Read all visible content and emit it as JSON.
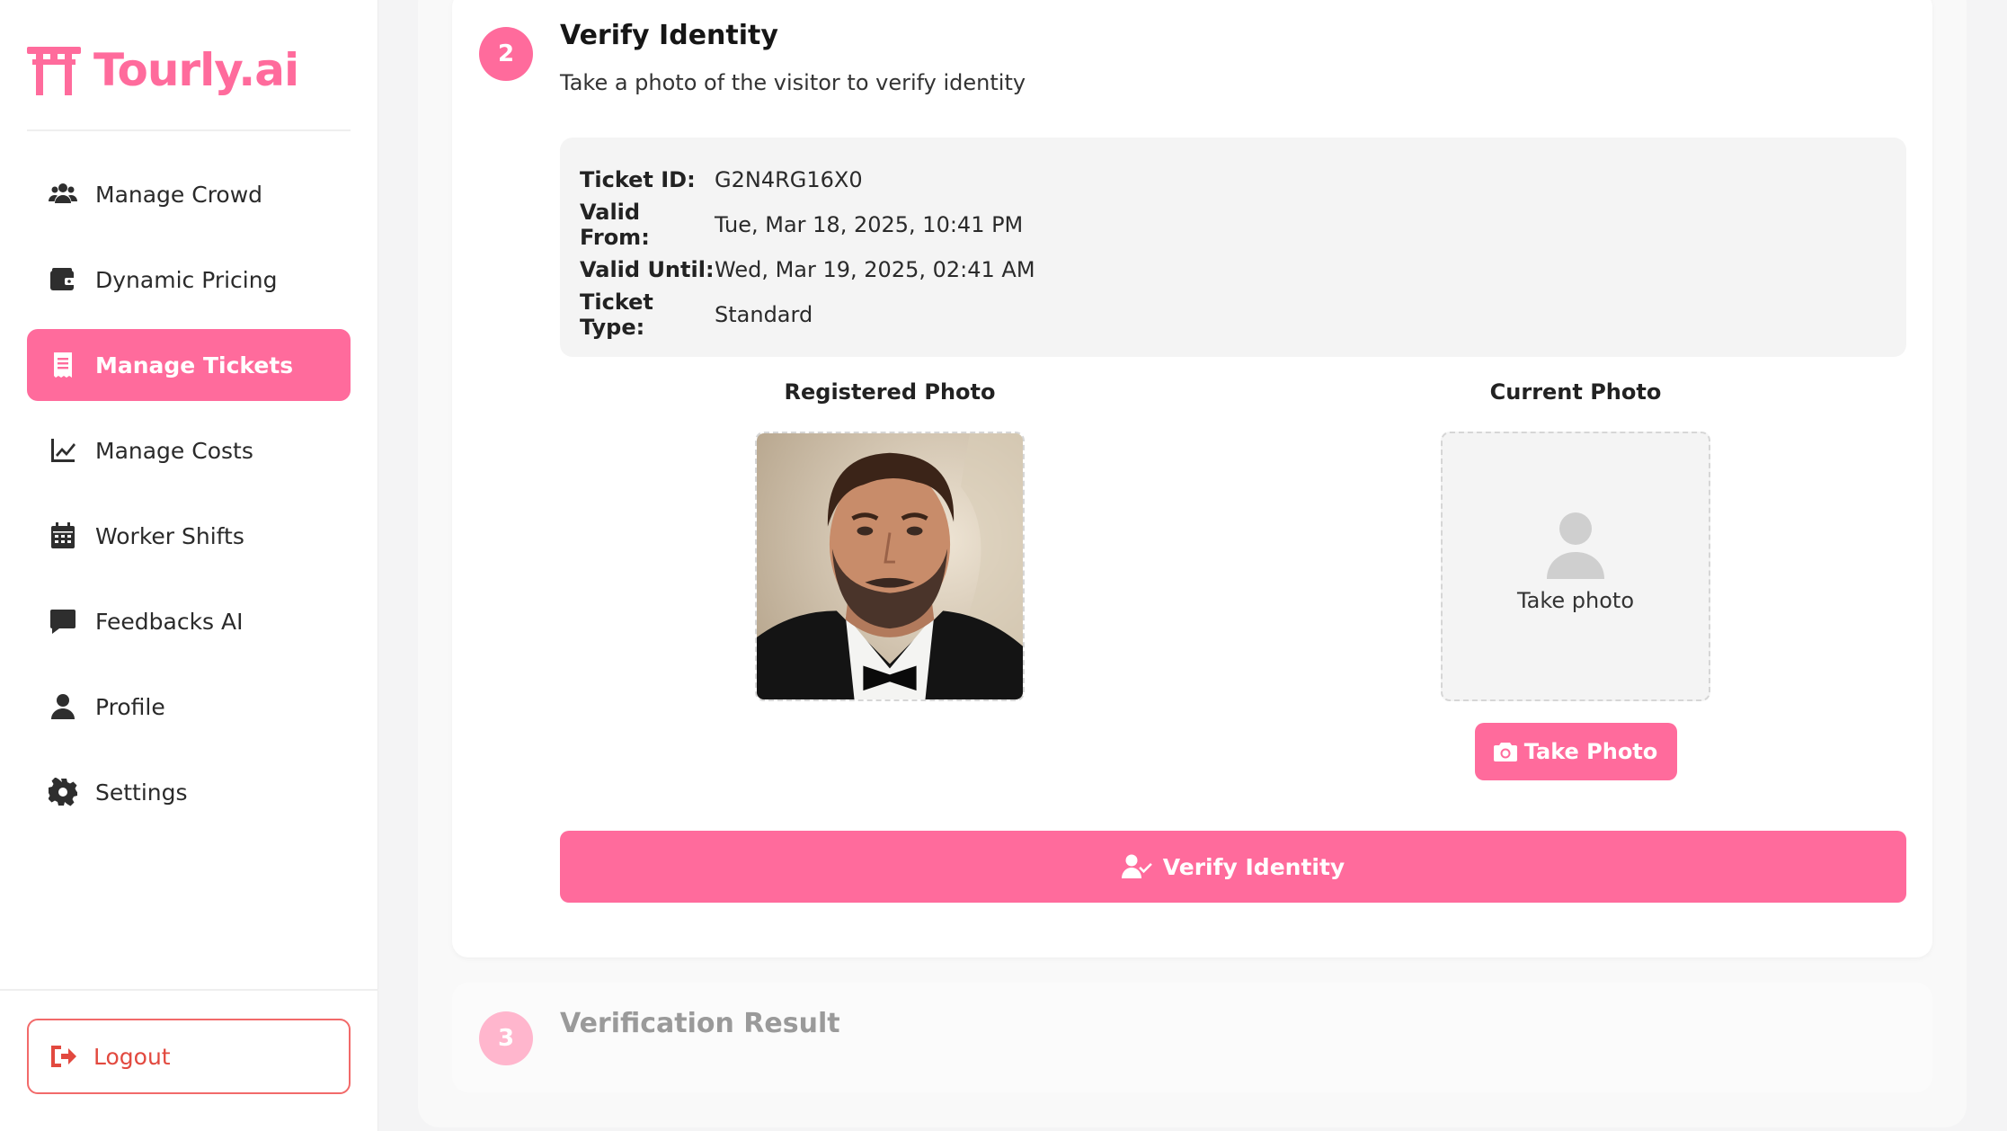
{
  "brand": {
    "name": "Tourly.ai",
    "color": "#ff6b9c"
  },
  "sidebar": {
    "items": [
      {
        "label": "Manage Crowd",
        "icon": "users-icon",
        "active": false
      },
      {
        "label": "Dynamic Pricing",
        "icon": "wallet-icon",
        "active": false
      },
      {
        "label": "Manage Tickets",
        "icon": "receipt-icon",
        "active": true
      },
      {
        "label": "Manage Costs",
        "icon": "line-chart-icon",
        "active": false
      },
      {
        "label": "Worker Shifts",
        "icon": "calendar-icon",
        "active": false
      },
      {
        "label": "Feedbacks AI",
        "icon": "comment-icon",
        "active": false
      },
      {
        "label": "Profile",
        "icon": "user-icon",
        "active": false
      },
      {
        "label": "Settings",
        "icon": "gear-icon",
        "active": false
      }
    ],
    "logout": "Logout"
  },
  "step2": {
    "number": "2",
    "title": "Verify Identity",
    "subtitle": "Take a photo of the visitor to verify identity",
    "ticket": {
      "id_label": "Ticket ID:",
      "id": "G2N4RG16X0",
      "from_label": "Valid From:",
      "from": "Tue, Mar 18, 2025, 10:41 PM",
      "until_label": "Valid Until:",
      "until": "Wed, Mar 19, 2025, 02:41 AM",
      "type_label": "Ticket Type:",
      "type": "Standard"
    },
    "registered_photo_title": "Registered Photo",
    "current_photo_title": "Current Photo",
    "take_photo_placeholder": "Take photo",
    "take_photo_button": "Take Photo",
    "verify_button": "Verify Identity"
  },
  "step3": {
    "number": "3",
    "title": "Verification Result"
  }
}
